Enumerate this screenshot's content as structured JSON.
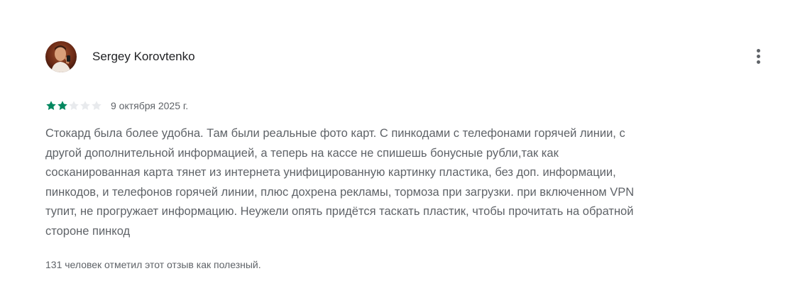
{
  "review": {
    "author": {
      "name": "Sergey Korovtenko",
      "avatar_icon": "user-photo-avatar"
    },
    "menu_icon": "more-vert-icon",
    "rating": {
      "value": 2,
      "max": 5,
      "filled_color": "#01875f",
      "empty_color": "#e8eaed"
    },
    "date": "9 октября 2025 г.",
    "text_lines": [
      "Стокард была более удобна. Там были реальные фото карт. С пинкодами с телефонами горячей линии, с",
      "другой дополнительной информацией, а теперь на кассе не спишешь бонусные рубли,так как",
      "сосканированная карта тянет из интернета унифицированную картинку пластика, без доп. информации,",
      "пинкодов, и телефонов горячей линии, плюс дохрена рекламы, тормоза при загрузки. при включенном VPN",
      "тупит, не прогружает информацию. Неужели опять придётся таскать пластик, чтобы прочитать на обратной",
      "стороне пинкод"
    ],
    "helpful_text": "131 человек отметил этот отзыв как полезный."
  }
}
